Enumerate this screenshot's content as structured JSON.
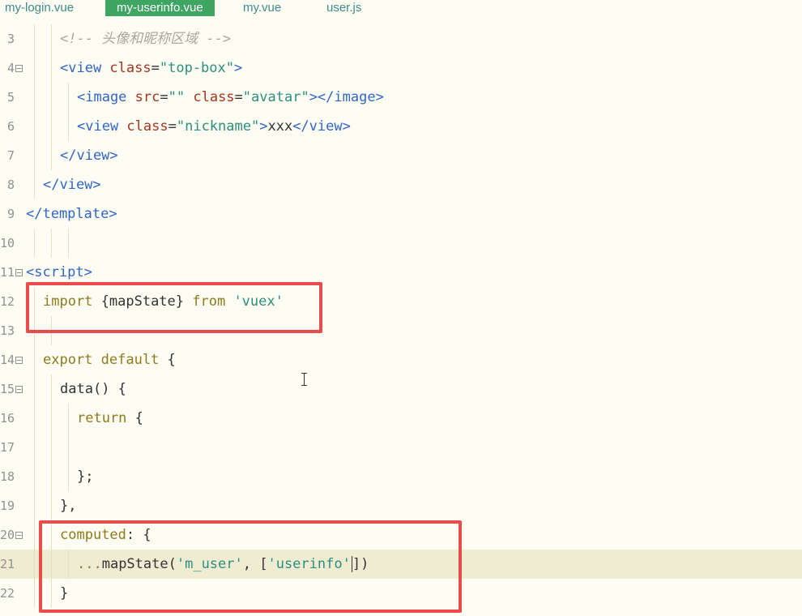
{
  "tabs": [
    {
      "label": "my-login.vue"
    },
    {
      "label": "my-userinfo.vue"
    },
    {
      "label": "my.vue"
    },
    {
      "label": "user.js"
    }
  ],
  "lines": [
    {
      "num": "3",
      "fold": false,
      "indent": 2,
      "tokens": [
        [
          "comment",
          "<!-- 头像和昵称区域 -->"
        ]
      ]
    },
    {
      "num": "4",
      "fold": true,
      "indent": 2,
      "tokens": [
        [
          "tag",
          "<view "
        ],
        [
          "attr",
          "class"
        ],
        [
          "text",
          "="
        ],
        [
          "str",
          "\"top-box\""
        ],
        [
          "tag",
          ">"
        ]
      ]
    },
    {
      "num": "5",
      "fold": false,
      "indent": 3,
      "tokens": [
        [
          "tag",
          "<image "
        ],
        [
          "attr",
          "src"
        ],
        [
          "text",
          "="
        ],
        [
          "str",
          "\"\""
        ],
        [
          "text",
          " "
        ],
        [
          "attr",
          "class"
        ],
        [
          "text",
          "="
        ],
        [
          "str",
          "\"avatar\""
        ],
        [
          "tag",
          "></image>"
        ]
      ]
    },
    {
      "num": "6",
      "fold": false,
      "indent": 3,
      "tokens": [
        [
          "tag",
          "<view "
        ],
        [
          "attr",
          "class"
        ],
        [
          "text",
          "="
        ],
        [
          "str",
          "\"nickname\""
        ],
        [
          "tag",
          ">"
        ],
        [
          "text",
          "xxx"
        ],
        [
          "tag",
          "</view>"
        ]
      ]
    },
    {
      "num": "7",
      "fold": false,
      "indent": 2,
      "tokens": [
        [
          "tag",
          "</view>"
        ]
      ]
    },
    {
      "num": "8",
      "fold": false,
      "indent": 1,
      "tokens": [
        [
          "tag",
          "</view>"
        ]
      ]
    },
    {
      "num": "9",
      "fold": false,
      "indent": 0,
      "tokens": [
        [
          "tag",
          "</template>"
        ]
      ]
    },
    {
      "num": "10",
      "fold": false,
      "indent": 0,
      "tokens": []
    },
    {
      "num": "11",
      "fold": true,
      "indent": 0,
      "tokens": [
        [
          "tag",
          "<script>"
        ]
      ]
    },
    {
      "num": "12",
      "fold": false,
      "indent": 1,
      "tokens": [
        [
          "kw",
          "import "
        ],
        [
          "text",
          "{mapState} "
        ],
        [
          "kw",
          "from "
        ],
        [
          "str",
          "'vuex'"
        ]
      ]
    },
    {
      "num": "13",
      "fold": false,
      "indent": 0,
      "tokens": []
    },
    {
      "num": "14",
      "fold": true,
      "indent": 1,
      "tokens": [
        [
          "kw",
          "export default "
        ],
        [
          "text",
          "{"
        ]
      ]
    },
    {
      "num": "15",
      "fold": true,
      "indent": 2,
      "tokens": [
        [
          "fn",
          "data"
        ],
        [
          "text",
          "() {"
        ]
      ]
    },
    {
      "num": "16",
      "fold": false,
      "indent": 3,
      "tokens": [
        [
          "kw",
          "return "
        ],
        [
          "text",
          "{"
        ]
      ]
    },
    {
      "num": "17",
      "fold": false,
      "indent": 0,
      "tokens": []
    },
    {
      "num": "18",
      "fold": false,
      "indent": 3,
      "tokens": [
        [
          "text",
          "};"
        ]
      ]
    },
    {
      "num": "19",
      "fold": false,
      "indent": 2,
      "tokens": [
        [
          "text",
          "},"
        ]
      ]
    },
    {
      "num": "20",
      "fold": true,
      "indent": 2,
      "tokens": [
        [
          "kw",
          "computed"
        ],
        [
          "text",
          ": {"
        ]
      ]
    },
    {
      "num": "21",
      "fold": false,
      "indent": 3,
      "highlight": true,
      "tokens": [
        [
          "kw",
          "..."
        ],
        [
          "fn",
          "mapState"
        ],
        [
          "text",
          "("
        ],
        [
          "str",
          "'m_user'"
        ],
        [
          "text",
          ", ["
        ],
        [
          "str",
          "'userinfo'"
        ],
        [
          "caret",
          ""
        ],
        [
          "text",
          "])"
        ]
      ]
    },
    {
      "num": "22",
      "fold": false,
      "indent": 2,
      "tokens": [
        [
          "text",
          "}"
        ]
      ]
    }
  ]
}
